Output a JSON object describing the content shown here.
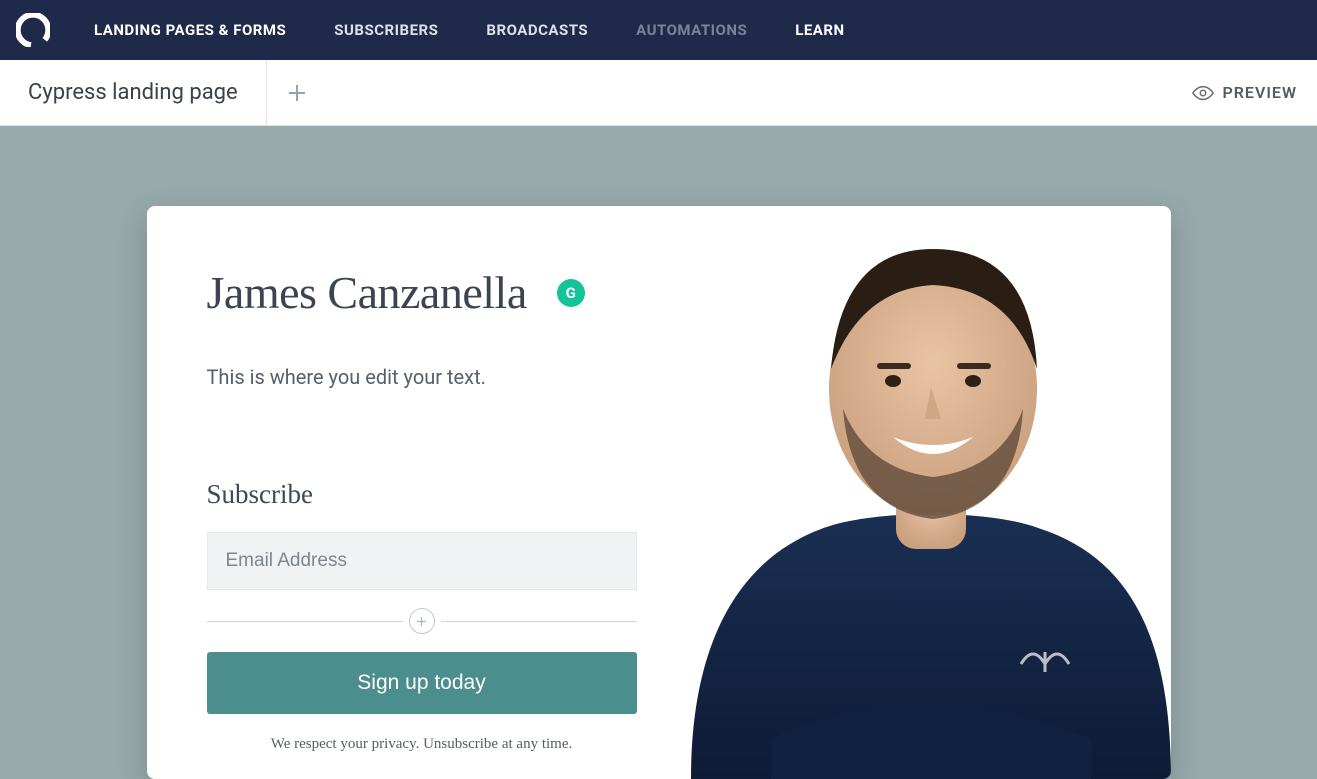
{
  "nav": {
    "items": [
      {
        "label": "LANDING PAGES & FORMS",
        "state": "active"
      },
      {
        "label": "SUBSCRIBERS",
        "state": "normal"
      },
      {
        "label": "BROADCASTS",
        "state": "normal"
      },
      {
        "label": "AUTOMATIONS",
        "state": "muted"
      },
      {
        "label": "LEARN",
        "state": "active"
      }
    ]
  },
  "subbar": {
    "page_name": "Cypress landing page",
    "preview_label": "PREVIEW"
  },
  "landing": {
    "headline": "James Canzanella",
    "grammarly_glyph": "G",
    "subtext": "This is where you edit your text.",
    "form": {
      "title": "Subscribe",
      "email_placeholder": "Email Address",
      "cta_label": "Sign up today",
      "privacy": "We respect your privacy. Unsubscribe at any time."
    }
  },
  "colors": {
    "topnav_bg": "#1f2a4a",
    "canvas_bg": "#97aaab",
    "cta_bg": "#4c8e8e",
    "grammarly_bg": "#15c39a"
  }
}
